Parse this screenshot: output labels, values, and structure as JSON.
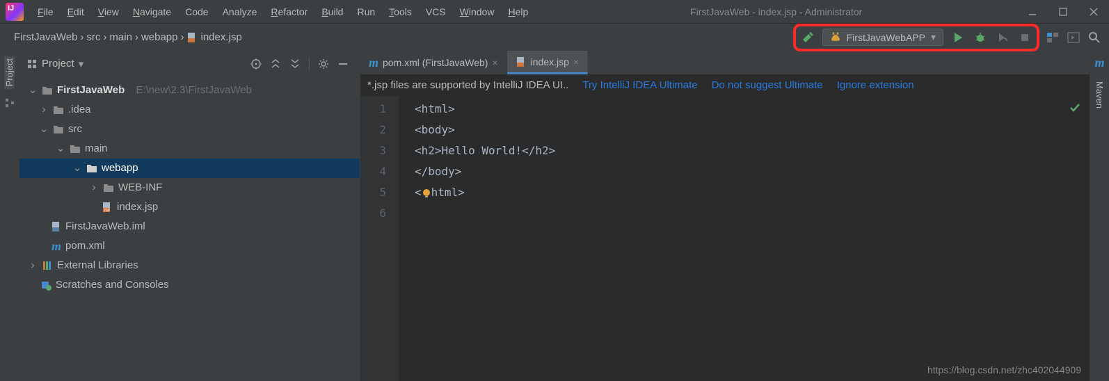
{
  "menu": [
    "File",
    "Edit",
    "View",
    "Navigate",
    "Code",
    "Analyze",
    "Refactor",
    "Build",
    "Run",
    "Tools",
    "VCS",
    "Window",
    "Help"
  ],
  "menu_mn": [
    "F",
    "E",
    "V",
    "N",
    "",
    "",
    "R",
    "B",
    "",
    "T",
    "",
    "W",
    "H"
  ],
  "window_title": "FirstJavaWeb - index.jsp - Administrator",
  "breadcrumb": [
    "FirstJavaWeb",
    "src",
    "main",
    "webapp",
    "index.jsp"
  ],
  "run_config": "FirstJavaWebAPP",
  "left_tool": "Project",
  "right_tool": "Maven",
  "tree_header": "Project",
  "tree": {
    "root": "FirstJavaWeb",
    "root_path": "E:\\new\\2.3\\FirstJavaWeb",
    "n_idea": ".idea",
    "n_src": "src",
    "n_main": "main",
    "n_webapp": "webapp",
    "n_webinf": "WEB-INF",
    "n_indexjsp": "index.jsp",
    "n_iml": "FirstJavaWeb.iml",
    "n_pom": "pom.xml",
    "n_ext": "External Libraries",
    "n_scr": "Scratches and Consoles"
  },
  "tabs": [
    {
      "label": "pom.xml (FirstJavaWeb)",
      "active": false,
      "icon": "m"
    },
    {
      "label": "index.jsp",
      "active": true,
      "icon": "jsp"
    }
  ],
  "banner": {
    "msg": "*.jsp files are supported by IntelliJ IDEA UI..",
    "link1": "Try IntelliJ IDEA Ultimate",
    "link2": "Do not suggest Ultimate",
    "link3": "Ignore extension"
  },
  "code_lines": [
    "<html>",
    "<body>",
    "<h2>Hello World!</h2>",
    "</body>",
    "</html>",
    ""
  ],
  "gutter": [
    "1",
    "2",
    "3",
    "4",
    "5",
    "6"
  ],
  "watermark": "https://blog.csdn.net/zhc402044909"
}
